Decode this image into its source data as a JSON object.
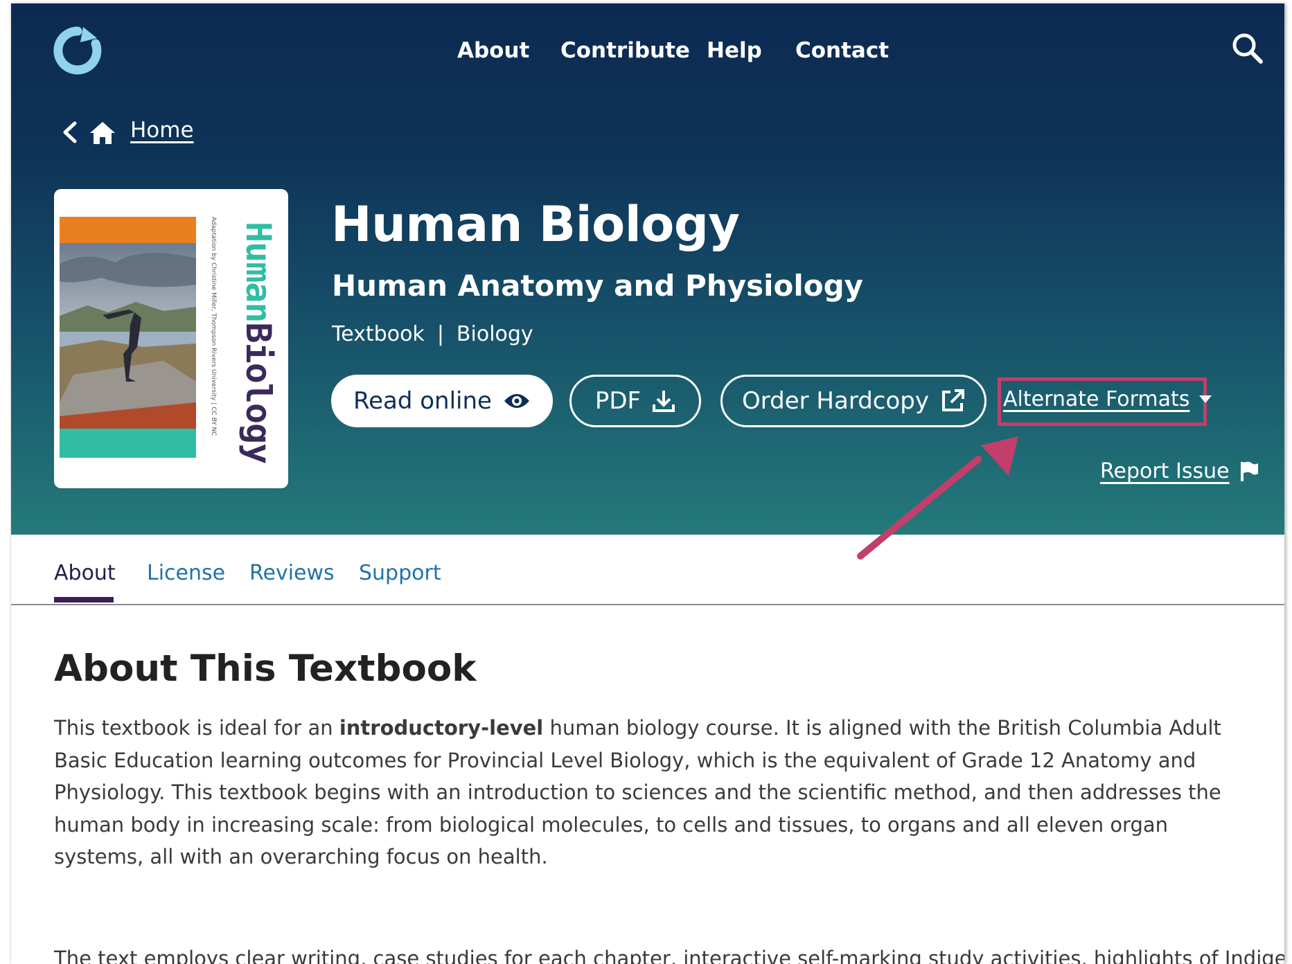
{
  "nav": {
    "items": [
      "About",
      "Contribute",
      "Help",
      "Contact"
    ]
  },
  "breadcrumb": {
    "home": "Home"
  },
  "cover": {
    "title_part1": "Human",
    "title_part2": "Biology",
    "subtitle": "Adaptation by Christine Miller, Thompson Rivers University | CC BY NC"
  },
  "book": {
    "title": "Human Biology",
    "subtitle": "Human Anatomy and Physiology",
    "type": "Textbook",
    "separator": "|",
    "subject": "Biology"
  },
  "actions": {
    "read_online": "Read online",
    "pdf": "PDF",
    "order_hardcopy": "Order Hardcopy",
    "alternate_formats": "Alternate Formats",
    "report_issue": "Report Issue"
  },
  "tabs": [
    {
      "label": "About",
      "active": true
    },
    {
      "label": "License",
      "active": false
    },
    {
      "label": "Reviews",
      "active": false
    },
    {
      "label": "Support",
      "active": false
    }
  ],
  "about": {
    "heading": "About This Textbook",
    "p1_before": "This textbook is ideal for an ",
    "p1_bold": "introductory-level",
    "p1_after": " human biology course. It is aligned with the British Columbia Adult Basic Education learning outcomes for Provincial Level Biology, which is the equivalent of Grade 12 Anatomy and Physiology. This textbook begins with an introduction to sciences and the scientific method, and then addresses the human body in increasing scale: from biological molecules, to cells and tissues, to organs and all eleven organ systems, all with an overarching focus on health.",
    "p2": "The text employs clear writing, case studies for each chapter, interactive self-marking study activities, highlights of Indigenous"
  },
  "colors": {
    "hero_top": "#0d2a52",
    "hero_bottom": "#247a7a",
    "highlight": "#c13f6a",
    "tab_link": "#2072a8",
    "tab_active_underline": "#3b1d57"
  }
}
